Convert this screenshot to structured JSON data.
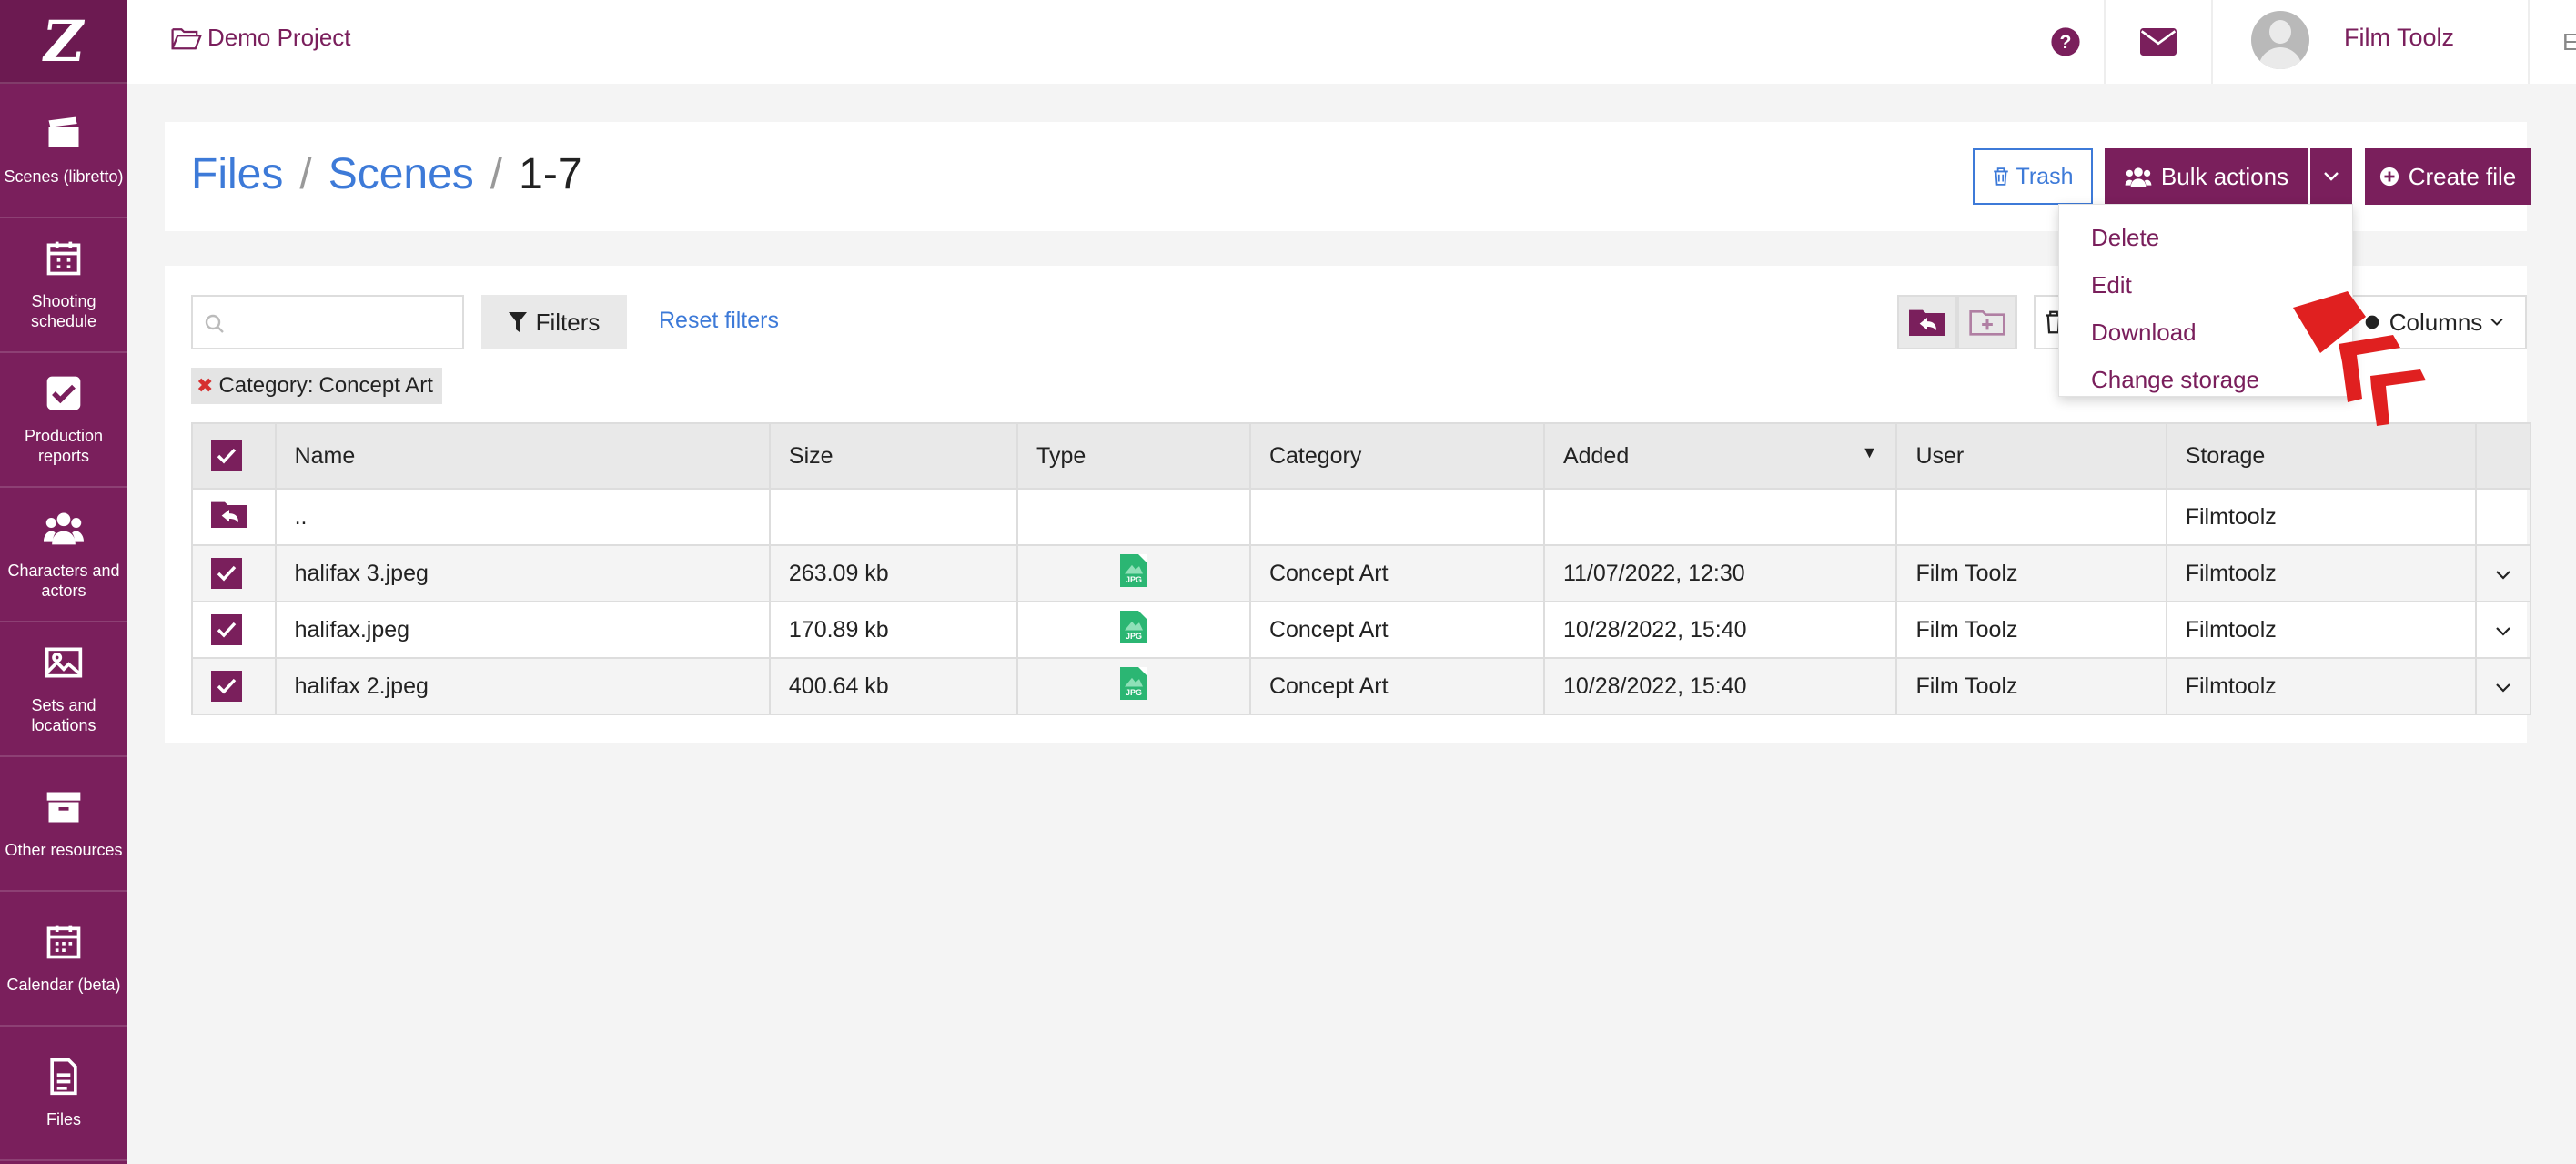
{
  "sidebar": {
    "logo": "Z",
    "items": [
      {
        "label": "Scenes (libretto)",
        "icon": "clapperboard-icon"
      },
      {
        "label": "Shooting schedule",
        "icon": "calendar-grid-icon"
      },
      {
        "label": "Production reports",
        "icon": "checkbox-icon"
      },
      {
        "label": "Characters and actors",
        "icon": "users-icon"
      },
      {
        "label": "Sets and locations",
        "icon": "image-icon"
      },
      {
        "label": "Other resources",
        "icon": "archive-box-icon"
      },
      {
        "label": "Calendar (beta)",
        "icon": "calendar-icon"
      },
      {
        "label": "Files",
        "icon": "file-icon"
      }
    ]
  },
  "topbar": {
    "project": "Demo Project",
    "username": "Film Toolz",
    "language": "EN"
  },
  "header": {
    "breadcrumb": [
      "Files",
      "Scenes",
      "1-7"
    ],
    "trash_label": "Trash",
    "bulk_label": "Bulk actions",
    "create_label": "Create file"
  },
  "bulk_menu": [
    "Delete",
    "Edit",
    "Download",
    "Change storage"
  ],
  "toolbar": {
    "search_placeholder": "",
    "filters_label": "Filters",
    "reset_label": "Reset filters",
    "columns_label": "Columns"
  },
  "active_filter": {
    "key": "Category:",
    "value": "Concept Art"
  },
  "table": {
    "headers": [
      "Name",
      "Size",
      "Type",
      "Category",
      "Added",
      "User",
      "Storage"
    ],
    "parent_row": {
      "name": "..",
      "storage": "Filmtoolz"
    },
    "rows": [
      {
        "name": "halifax 3.jpeg",
        "size": "263.09 kb",
        "type": "JPG",
        "category": "Concept Art",
        "added": "11/07/2022, 12:30",
        "user": "Film Toolz",
        "storage": "Filmtoolz"
      },
      {
        "name": "halifax.jpeg",
        "size": "170.89 kb",
        "type": "JPG",
        "category": "Concept Art",
        "added": "10/28/2022, 15:40",
        "user": "Film Toolz",
        "storage": "Filmtoolz"
      },
      {
        "name": "halifax 2.jpeg",
        "size": "400.64 kb",
        "type": "JPG",
        "category": "Concept Art",
        "added": "10/28/2022, 15:40",
        "user": "Film Toolz",
        "storage": "Filmtoolz"
      }
    ]
  },
  "colors": {
    "brand": "#7a1f5c",
    "link": "#3d7ad8"
  }
}
